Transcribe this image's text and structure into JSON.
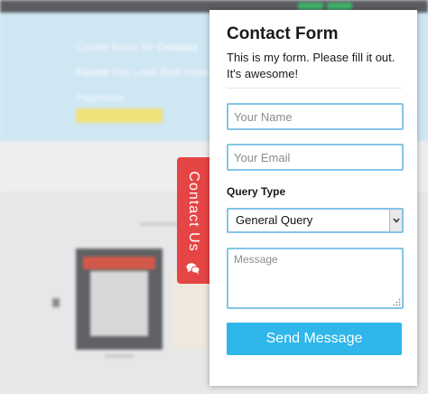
{
  "background_page": {
    "hero_text_plain": "Create forms for ",
    "hero_text_bold": "Contact Forms",
    "hero_text_tail": " Get Lead Bold Instant Payments"
  },
  "contact_tab": {
    "label": "Contact Us",
    "icon": "chat-bubbles-icon",
    "color": "#e64545"
  },
  "form": {
    "title": "Contact Form",
    "description": "This is my form. Please fill it out. It's awesome!",
    "name_placeholder": "Your Name",
    "email_placeholder": "Your Email",
    "query_label": "Query Type",
    "query_selected": "General Query",
    "message_placeholder": "Message",
    "submit_label": "Send Message",
    "accent_color": "#2fb6ea",
    "field_border_color": "#86c4e8"
  }
}
